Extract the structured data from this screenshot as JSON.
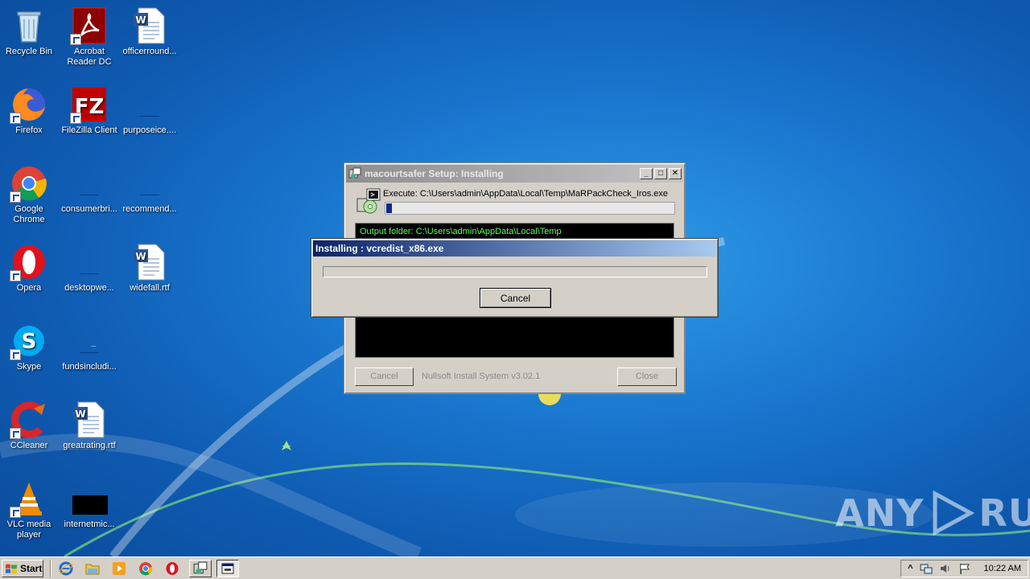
{
  "desktop": {
    "icons": [
      {
        "label": "Recycle Bin",
        "icon": "recycle-bin-icon"
      },
      {
        "label": "Acrobat Reader DC",
        "icon": "acrobat-icon"
      },
      {
        "label": "officerround...",
        "icon": "word-document-icon"
      },
      {
        "label": "Firefox",
        "icon": "firefox-icon"
      },
      {
        "label": "FileZilla Client",
        "icon": "filezilla-icon"
      },
      {
        "label": "purposeice....",
        "icon": "blank-file-icon"
      },
      {
        "label": "Google Chrome",
        "icon": "chrome-icon"
      },
      {
        "label": "consumerbri...",
        "icon": "blank-file-icon"
      },
      {
        "label": "recommend...",
        "icon": "blank-file-icon"
      },
      {
        "label": "Opera",
        "icon": "opera-icon"
      },
      {
        "label": "desktopwe...",
        "icon": "blank-file-icon"
      },
      {
        "label": "widefall.rtf",
        "icon": "word-document-icon"
      },
      {
        "label": "Skype",
        "icon": "skype-icon"
      },
      {
        "label": "fundsincludi...",
        "icon": "blank-file-icon"
      },
      {
        "label": "CCleaner",
        "icon": "ccleaner-icon"
      },
      {
        "label": "greatrating.rtf",
        "icon": "word-document-icon"
      },
      {
        "label": "VLC media player",
        "icon": "vlc-icon"
      },
      {
        "label": "internetmic...",
        "icon": "black-file-icon"
      }
    ]
  },
  "watermark": {
    "left": "ANY",
    "right": "RUN"
  },
  "installer": {
    "title": "macourtsafer Setup: Installing",
    "execute_text": "Execute: C:\\Users\\admin\\AppData\\Local\\Temp\\MaRPackCheck_Iros.exe",
    "progress": 0.02,
    "log_line": "Output folder: C:\\Users\\admin\\AppData\\Local\\Temp",
    "cancel_label": "Cancel",
    "brand_label": "Nullsoft Install System v3.02.1",
    "close_label": "Close",
    "minimize_glyph": "_",
    "maximize_glyph": "□",
    "close_glyph": "✕"
  },
  "dialog": {
    "title": "Installing : vcredist_x86.exe",
    "progress": 0.0,
    "cancel_label": "Cancel"
  },
  "taskbar": {
    "start_label": "Start",
    "clock": "10:22 AM",
    "tray_expand_glyph": "^"
  },
  "colors": {
    "title_active_start": "#0a246a",
    "title_active_end": "#a6caf0",
    "log_text": "#5cff5c",
    "progress_fill": "#0c2a8a"
  }
}
